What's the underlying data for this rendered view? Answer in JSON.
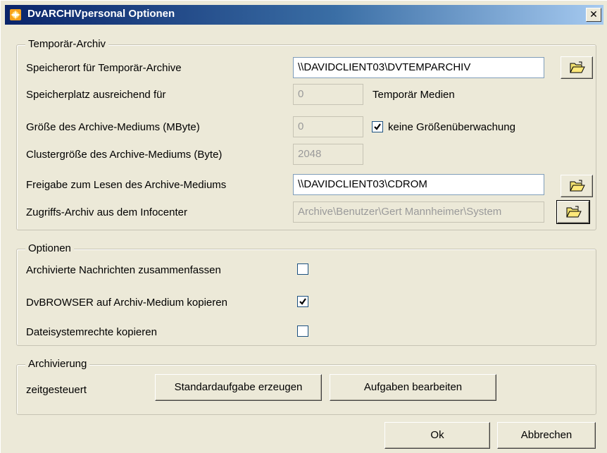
{
  "window": {
    "title": "DvARCHIVpersonal Optionen",
    "close_glyph": "✕"
  },
  "temp_archive": {
    "legend": "Temporär-Archiv",
    "location_label": "Speicherort für Temporär-Archive",
    "location_value": "\\\\DAVIDCLIENT03\\DVTEMPARCHIV",
    "space_label": "Speicherplatz ausreichend für",
    "space_value": "0",
    "space_suffix": "Temporär Medien",
    "size_label": "Größe des Archive-Mediums (MByte)",
    "size_value": "0",
    "no_size_check_label": "keine Größenüberwachung",
    "no_size_check_checked": true,
    "cluster_label": "Clustergröße des Archive-Mediums (Byte)",
    "cluster_value": "2048",
    "share_label": "Freigabe zum Lesen des Archive-Mediums",
    "share_value": "\\\\DAVIDCLIENT03\\CDROM",
    "access_label": "Zugriffs-Archiv aus dem Infocenter",
    "access_value": "Archive\\Benutzer\\Gert Mannheimer\\System"
  },
  "options": {
    "legend": "Optionen",
    "items": [
      {
        "label": "Archivierte Nachrichten zusammenfassen",
        "checked": false
      },
      {
        "label": "DvBROWSER auf Archiv-Medium kopieren",
        "checked": true
      },
      {
        "label": "Dateisystemrechte kopieren",
        "checked": false
      }
    ]
  },
  "archiving": {
    "legend": "Archivierung",
    "label": "zeitgesteuert",
    "create_task_button": "Standardaufgabe erzeugen",
    "edit_tasks_button": "Aufgaben bearbeiten"
  },
  "footer": {
    "ok_button": "Ok",
    "cancel_button": "Abbrechen"
  },
  "colors": {
    "face": "#ece9d8",
    "title_start": "#0a246a",
    "title_end": "#a6caf0",
    "field_border": "#7f9db9"
  },
  "icons": {
    "app": "app-icon",
    "browse": "open-folder-icon",
    "check": "checkmark-icon"
  }
}
